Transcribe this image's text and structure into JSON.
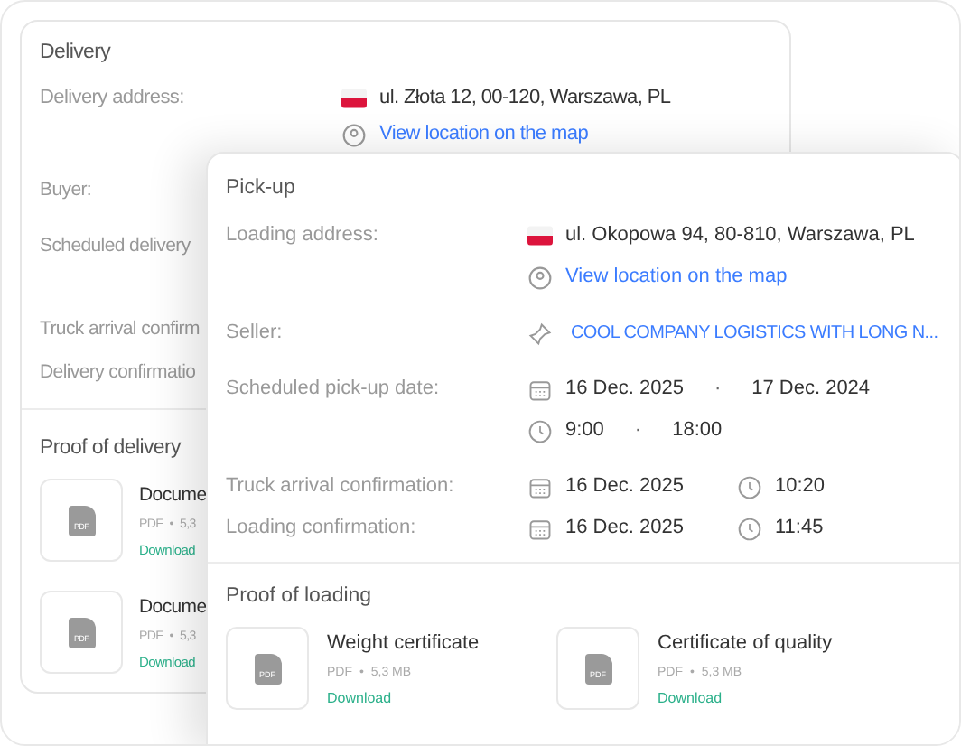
{
  "delivery": {
    "title": "Delivery",
    "address_label": "Delivery address:",
    "address": "ul. Złota 12, 00-120, Warszawa, PL",
    "map_link": "View location on the map",
    "buyer_label": "Buyer:",
    "scheduled_label": "Scheduled delivery",
    "truck_label": "Truck arrival confirm",
    "confirmation_label": "Delivery confirmatio",
    "proof_title": "Proof of delivery",
    "documents": [
      {
        "icon_label": "PDF",
        "name": "Docume",
        "type": "PDF",
        "separator": "•",
        "size": "5,3",
        "action": "Download"
      },
      {
        "icon_label": "PDF",
        "name": "Docume",
        "type": "PDF",
        "separator": "•",
        "size": "5,3",
        "action": "Download"
      }
    ]
  },
  "pickup": {
    "title": "Pick-up",
    "address_label": "Loading address:",
    "address": "ul. Okopowa 94, 80-810, Warszawa, PL",
    "map_link": "View location on the map",
    "seller_label": "Seller:",
    "seller": "COOL COMPANY LOGISTICS WITH LONG N...",
    "scheduled_label": "Scheduled pick-up date:",
    "date_from": "16 Dec. 2025",
    "date_separator": "·",
    "date_to": "17 Dec. 2024",
    "time_from": "9:00",
    "time_separator": "·",
    "time_to": "18:00",
    "truck_label": "Truck arrival confirmation:",
    "truck_date": "16 Dec. 2025",
    "truck_time": "10:20",
    "loading_label": "Loading confirmation:",
    "loading_date": "16 Dec. 2025",
    "loading_time": "11:45",
    "proof_title": "Proof of loading",
    "documents": [
      {
        "icon_label": "PDF",
        "name": "Weight certificate",
        "type": "PDF",
        "separator": "•",
        "size": "5,3 MB",
        "action": "Download"
      },
      {
        "icon_label": "PDF",
        "name": "Certificate of quality",
        "type": "PDF",
        "separator": "•",
        "size": "5,3 MB",
        "action": "Download"
      }
    ]
  }
}
